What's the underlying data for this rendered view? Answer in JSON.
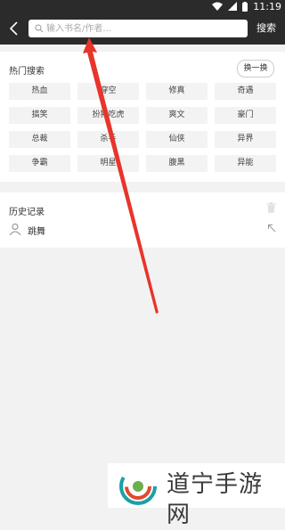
{
  "status_bar": {
    "time": "11:19",
    "icons": [
      "wifi-icon",
      "signal-icon",
      "battery-icon"
    ]
  },
  "app_bar": {
    "back_icon": "back-chevron-icon",
    "search_placeholder": "输入书名/作者...",
    "search_value": "",
    "search_button": "搜索"
  },
  "hot_search": {
    "title": "热门搜索",
    "refresh_label": "换一换",
    "tags": [
      "热血",
      "穿空",
      "修真",
      "奇遇",
      "搞笑",
      "扮猪吃虎",
      "爽文",
      "豪门",
      "总裁",
      "杀手",
      "仙侠",
      "异界",
      "争霸",
      "明星",
      "腹黑",
      "异能"
    ]
  },
  "history": {
    "title": "历史记录",
    "clear_icon": "trash-icon",
    "items": [
      {
        "text": "跳舞",
        "icon": "user-icon",
        "action_icon": "arrow-up-left-icon"
      }
    ]
  },
  "watermark": {
    "text": "道宁手游网"
  },
  "colors": {
    "app_bar": "#2b2b2b",
    "background": "#f2f2f2",
    "tag_bg": "#f3f3f3",
    "annotation": "#e8342a"
  }
}
